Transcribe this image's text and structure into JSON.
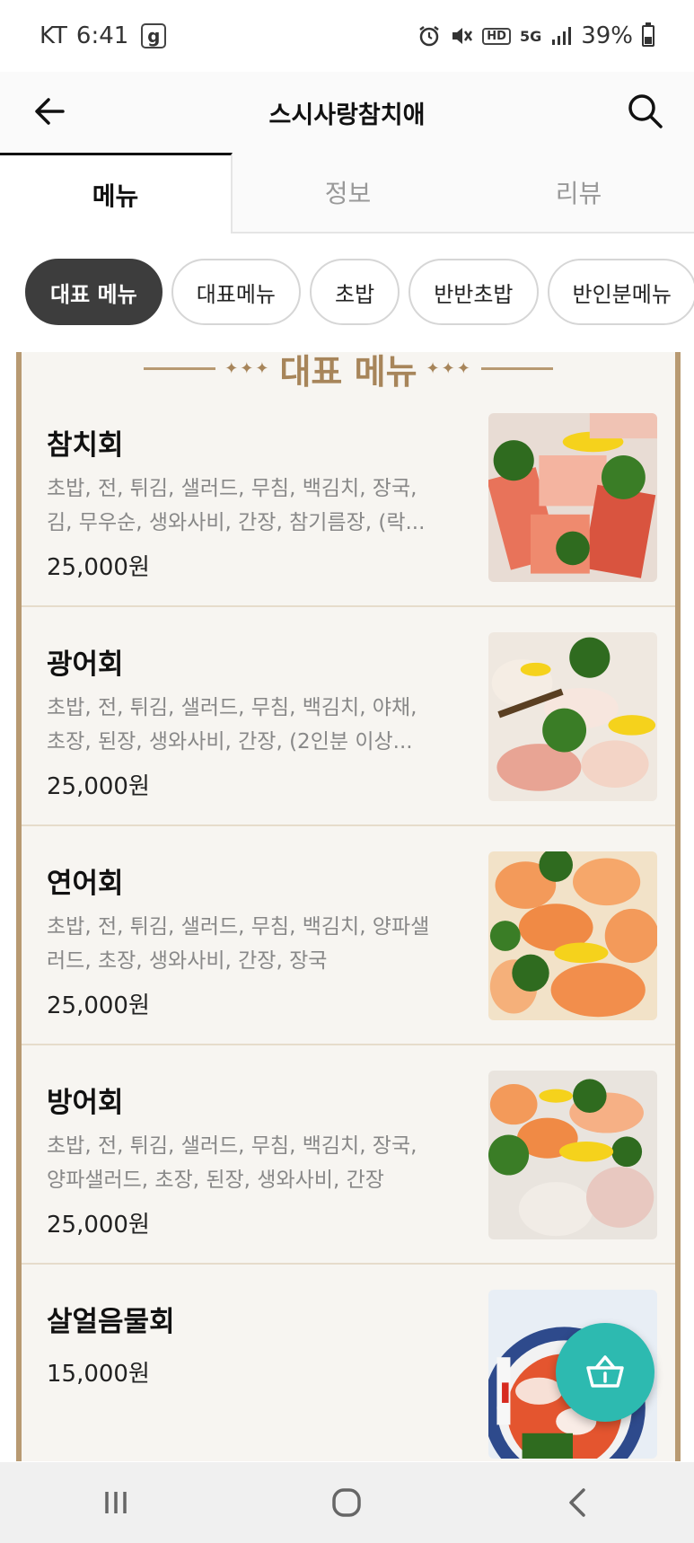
{
  "status_bar": {
    "carrier": "KT",
    "time": "6:41",
    "notification": "g",
    "network": "5G",
    "hd": "HD",
    "battery": "39%",
    "battery_level": 0.39
  },
  "header": {
    "title": "스시사랑참치애",
    "back_icon": "arrow-left-icon",
    "search_icon": "search-icon"
  },
  "tabs": [
    {
      "label": "메뉴",
      "active": true
    },
    {
      "label": "정보",
      "active": false
    },
    {
      "label": "리뷰",
      "active": false
    }
  ],
  "chips": [
    {
      "label": "대표 메뉴",
      "active": true
    },
    {
      "label": "대표메뉴",
      "active": false
    },
    {
      "label": "초밥",
      "active": false
    },
    {
      "label": "반반초밥",
      "active": false
    },
    {
      "label": "반인분메뉴",
      "active": false
    }
  ],
  "section": {
    "title": "대표 메뉴"
  },
  "menu_items": [
    {
      "name": "참치회",
      "desc": "초밥, 전, 튀김, 샐러드, 무침, 백김치, 장국, 김, 무우순, 생와사비, 간장, 참기름장, (락...",
      "price": "25,000원"
    },
    {
      "name": "광어회",
      "desc": "초밥, 전, 튀김, 샐러드, 무침, 백김치, 야채, 초장, 된장, 생와사비, 간장, (2인분 이상...",
      "price": "25,000원"
    },
    {
      "name": "연어회",
      "desc": "초밥, 전, 튀김, 샐러드, 무침, 백김치, 양파샐러드, 초장, 생와사비, 간장, 장국",
      "price": "25,000원"
    },
    {
      "name": "방어회",
      "desc": "초밥, 전, 튀김, 샐러드, 무침, 백김치, 장국, 양파샐러드, 초장, 된장, 생와사비, 간장",
      "price": "25,000원"
    },
    {
      "name": "살얼음물회",
      "desc": "",
      "price": "15,000원"
    }
  ],
  "colors": {
    "accent": "#2dbab0",
    "board_border": "#b89a72",
    "board_bg": "#f7f5f1",
    "chip_active": "#3d3d3d"
  },
  "cart_icon": "basket-icon",
  "nav": [
    "recent-apps-icon",
    "home-icon",
    "back-icon"
  ]
}
